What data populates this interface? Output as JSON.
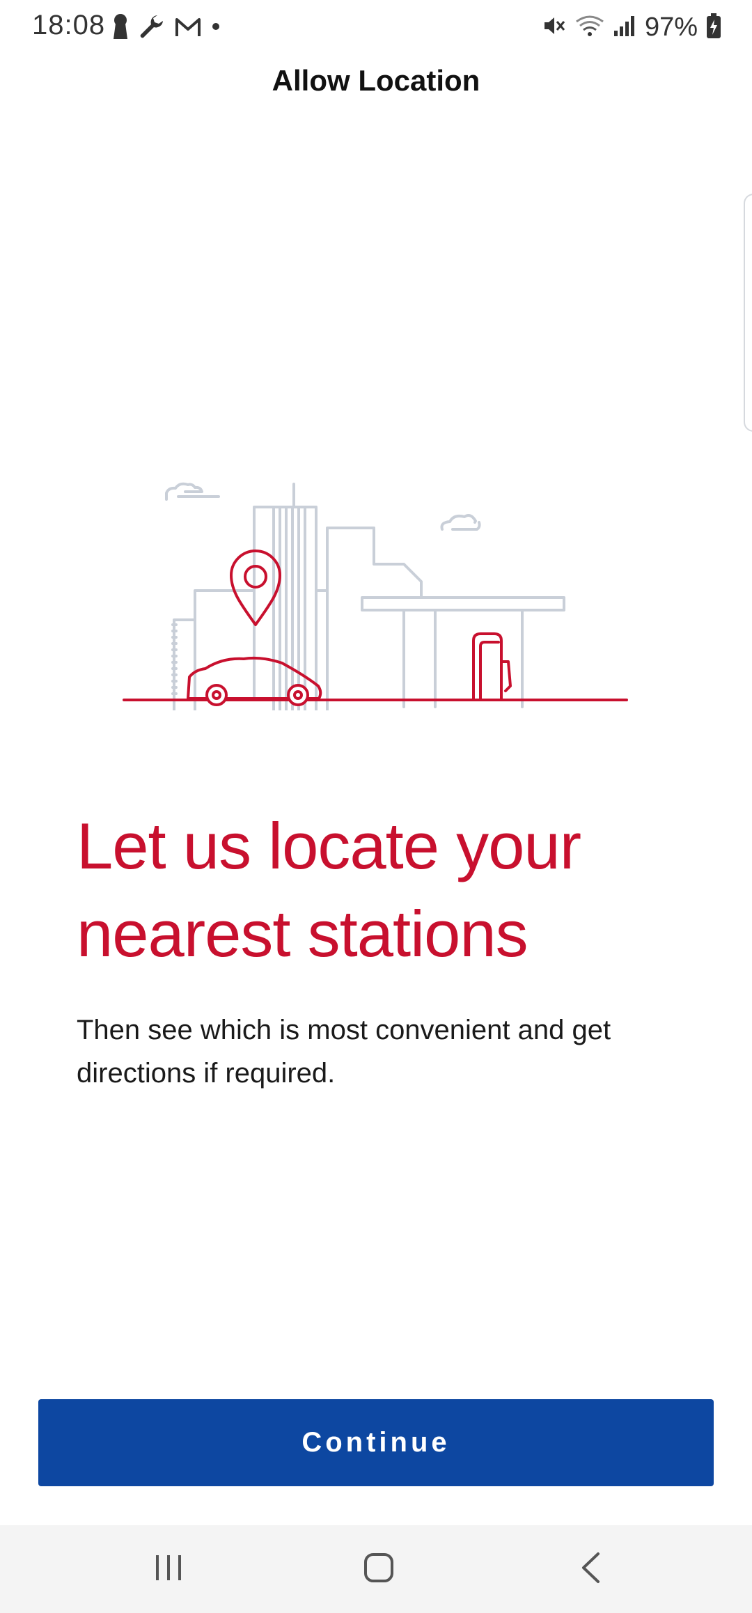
{
  "status_bar": {
    "time": "18:08",
    "battery": "97%",
    "left_icons": [
      "keyhole-icon",
      "wrench-icon",
      "gmail-icon",
      "dot-icon"
    ],
    "right_icons": [
      "mute-icon",
      "wifi-icon",
      "signal-icon",
      "battery-charging-icon"
    ]
  },
  "app_bar": {
    "title": "Allow Location"
  },
  "content": {
    "headline_line1": "Let us locate your",
    "headline_line2": "nearest stations",
    "body": "Then see which is most convenient and get directions if required."
  },
  "actions": {
    "continue_label": "Continue"
  },
  "nav_bar": {
    "items": [
      "recents-icon",
      "home-icon",
      "back-icon"
    ]
  },
  "colors": {
    "brand_red": "#c8102e",
    "button_blue": "#0d47a1",
    "illustration_grey": "#c9cfd8",
    "nav_background": "#f4f4f4"
  }
}
